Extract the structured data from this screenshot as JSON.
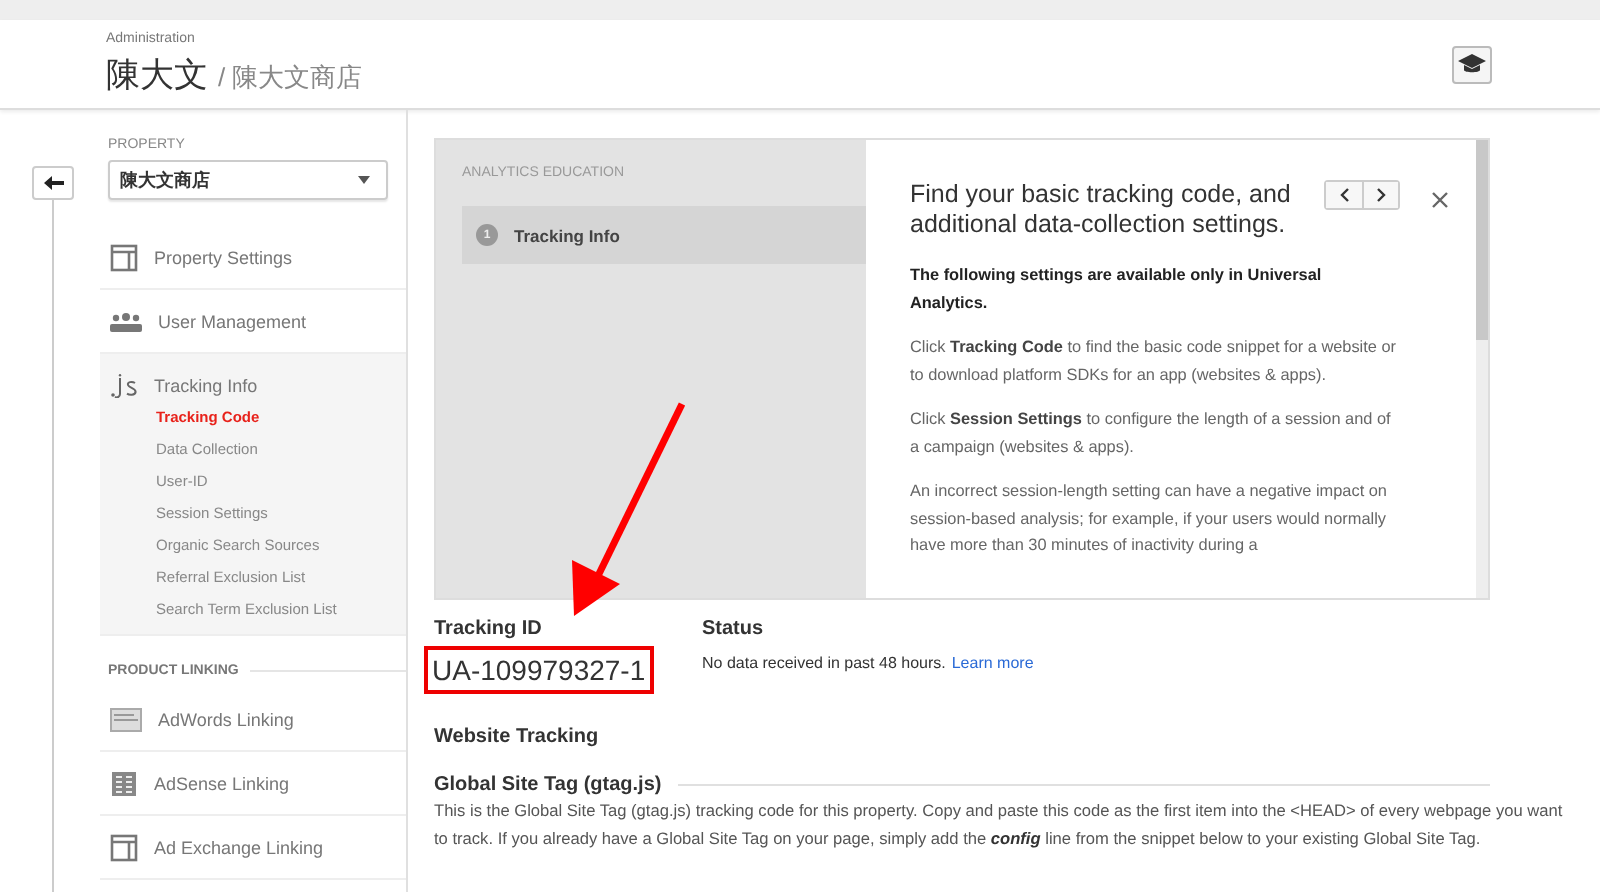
{
  "header": {
    "breadcrumb": "Administration",
    "account": "陳大文",
    "property": "/ 陳大文商店"
  },
  "sidebar": {
    "property_label": "PROPERTY",
    "property_select": "陳大文商店",
    "items": [
      {
        "label": "Property Settings",
        "kind": "settings",
        "expanded": false
      },
      {
        "label": "User Management",
        "kind": "users",
        "expanded": false
      },
      {
        "label": "Tracking Info",
        "kind": "js",
        "expanded": true,
        "children": [
          {
            "label": "Tracking Code",
            "selected": true
          },
          {
            "label": "Data Collection",
            "selected": false
          },
          {
            "label": "User-ID",
            "selected": false
          },
          {
            "label": "Session Settings",
            "selected": false
          },
          {
            "label": "Organic Search Sources",
            "selected": false
          },
          {
            "label": "Referral Exclusion List",
            "selected": false
          },
          {
            "label": "Search Term Exclusion List",
            "selected": false
          }
        ]
      }
    ],
    "section": "PRODUCT LINKING",
    "linking": [
      {
        "label": "AdWords Linking",
        "kind": "adwords"
      },
      {
        "label": "AdSense Linking",
        "kind": "adsense"
      },
      {
        "label": "Ad Exchange Linking",
        "kind": "adx"
      }
    ]
  },
  "education": {
    "label": "ANALYTICS EDUCATION",
    "steps": [
      {
        "number": "1",
        "label": "Tracking Info",
        "selected": true
      }
    ],
    "title": "Find your basic tracking code, and additional data-collection settings.",
    "paragraphs": [
      {
        "kind": "lead",
        "text": "The following settings are available only in Universal Analytics."
      },
      {
        "kind": "body",
        "text": "Click **Tracking Code** to find the basic code snippet for a website or to download platform SDKs for an app (websites & apps)."
      },
      {
        "kind": "body",
        "text": "Click **Session Settings** to configure the length of a session and of a campaign (websites & apps)."
      },
      {
        "kind": "body",
        "text": "An incorrect session-length setting can have a negative impact on session-based analysis; for example, if your users would normally have more than 30 minutes of inactivity during a"
      }
    ]
  },
  "tracking": {
    "id_label": "Tracking ID",
    "id": "UA-109979327-1",
    "status_label": "Status",
    "status": "No data received in past 48 hours.",
    "status_link": "Learn more"
  },
  "website_tracking": "Website Tracking",
  "gtag": {
    "title": "Global Site Tag (gtag.js)",
    "description": "This is the Global Site Tag (gtag.js) tracking code for this property. Copy and paste this code as the first item into the <HEAD> of every webpage you want to track. If you already have a Global Site Tag on your page, simply add the *config* line from the snippet below to your existing Global Site Tag."
  }
}
